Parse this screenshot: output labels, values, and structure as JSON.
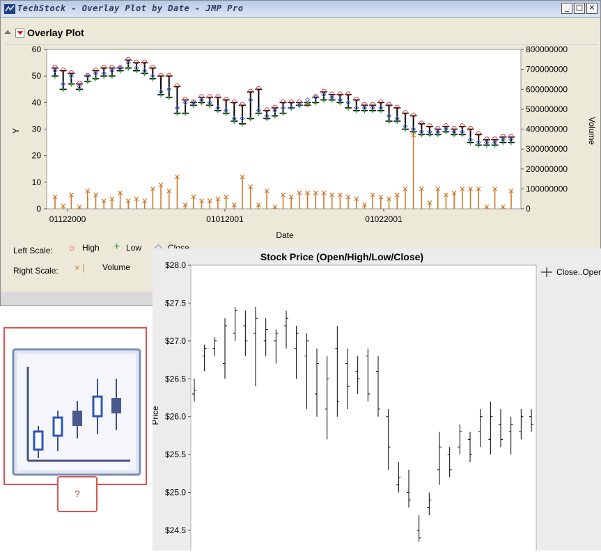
{
  "window": {
    "title": "TechStock - Overlay Plot by Date - JMP Pro",
    "buttons": {
      "minimize": "_",
      "maximize": "□",
      "close": "×"
    }
  },
  "overlay_plot": {
    "title": "Overlay Plot",
    "x_label": "Date",
    "y_label": "Y",
    "y2_label": "Volume",
    "left_axis_ticks": [
      "0",
      "10",
      "20",
      "30",
      "40",
      "50",
      "60"
    ],
    "right_axis_ticks": [
      "0",
      "100000000",
      "200000000",
      "300000000",
      "400000000",
      "500000000",
      "600000000",
      "700000000",
      "800000000"
    ],
    "x_ticks": [
      "01122000",
      "01012001",
      "01022001"
    ],
    "legend": {
      "left_scale_label": "Left Scale:",
      "right_scale_label": "Right Scale:",
      "high": "High",
      "low": "Low",
      "close": "Close",
      "volume_markers": "×   |",
      "volume": "Volume",
      "high_marker": "○",
      "low_marker": "+",
      "close_marker": "◇"
    },
    "colors": {
      "high": "#d33b3b",
      "low": "#2f9c2f",
      "close": "#4a6fd6",
      "volume": "#d0792a"
    }
  },
  "stock_chart": {
    "title": "Stock Price (Open/High/Low/Close)",
    "y_label": "Price",
    "y_ticks": [
      "$24.5",
      "$25.0",
      "$25.5",
      "$26.0",
      "$26.5",
      "$27.0",
      "$27.5",
      "$28.0"
    ],
    "legend_label": "Close..Open"
  },
  "chart_icon": {
    "name": "candlestick-chart-icon"
  },
  "help_box": {
    "text": "?"
  },
  "chart_data": [
    {
      "type": "line",
      "title": "Overlay Plot",
      "xlabel": "Date",
      "ylabel": "Y",
      "y2label": "Volume",
      "ylim": [
        0,
        60
      ],
      "y2lim": [
        0,
        800000000
      ],
      "x_ticks": [
        "01122000",
        "01012001",
        "01022001"
      ],
      "series": [
        {
          "name": "High",
          "axis": "left",
          "values": [
            53,
            52,
            51,
            47,
            50,
            52,
            53,
            53,
            53,
            56,
            55,
            55,
            53,
            50,
            50,
            46,
            41,
            40,
            42,
            42,
            42,
            41,
            40,
            39,
            44,
            45,
            37,
            38,
            40,
            40,
            40,
            39,
            42,
            44,
            43,
            43,
            43,
            41,
            39,
            39,
            40,
            39,
            38,
            36,
            35,
            32,
            31,
            30,
            31,
            30,
            31,
            30,
            28,
            26,
            26,
            27,
            27
          ]
        },
        {
          "name": "Low",
          "axis": "left",
          "values": [
            50,
            45,
            47,
            45,
            48,
            49,
            50,
            50,
            52,
            53,
            52,
            51,
            49,
            43,
            42,
            36,
            36,
            39,
            40,
            39,
            37,
            36,
            33,
            32,
            34,
            36,
            34,
            35,
            36,
            38,
            39,
            40,
            40,
            41,
            41,
            40,
            38,
            37,
            37,
            37,
            37,
            33,
            33,
            30,
            29,
            28,
            28,
            28,
            29,
            28,
            28,
            25,
            24,
            24,
            24,
            25,
            25
          ]
        },
        {
          "name": "Close",
          "axis": "left",
          "values": [
            52,
            47,
            50,
            46,
            50,
            51,
            51,
            52,
            53,
            55,
            53,
            52,
            50,
            44,
            45,
            38,
            40,
            40,
            41,
            40,
            38,
            37,
            34,
            34,
            41,
            37,
            35,
            37,
            38,
            38,
            39,
            41,
            42,
            43,
            42,
            41,
            40,
            38,
            38,
            38,
            38,
            35,
            34,
            31,
            30,
            29,
            29,
            29,
            30,
            29,
            29,
            26,
            25,
            25,
            25,
            26,
            26
          ]
        },
        {
          "name": "Volume",
          "axis": "right",
          "values": [
            60000000,
            15000000,
            70000000,
            10000000,
            90000000,
            70000000,
            40000000,
            50000000,
            80000000,
            40000000,
            50000000,
            40000000,
            100000000,
            120000000,
            90000000,
            160000000,
            20000000,
            60000000,
            40000000,
            40000000,
            50000000,
            60000000,
            20000000,
            160000000,
            110000000,
            20000000,
            90000000,
            10000000,
            70000000,
            60000000,
            80000000,
            80000000,
            80000000,
            80000000,
            70000000,
            70000000,
            60000000,
            50000000,
            20000000,
            70000000,
            60000000,
            50000000,
            70000000,
            100000000,
            370000000,
            100000000,
            30000000,
            100000000,
            70000000,
            80000000,
            100000000,
            100000000,
            100000000,
            10000000,
            100000000,
            10000000,
            90000000
          ]
        }
      ]
    },
    {
      "type": "line",
      "title": "Stock Price (Open/High/Low/Close)",
      "ylabel": "Price",
      "ylim": [
        24.3,
        28.0
      ],
      "series": [
        {
          "name": "Close..Open",
          "note": "OHLC bars",
          "values": [
            {
              "h": 26.5,
              "l": 26.2,
              "o": 26.3,
              "c": 26.35
            },
            {
              "h": 26.95,
              "l": 26.6,
              "o": 26.8,
              "c": 26.9
            },
            {
              "h": 27.05,
              "l": 26.8,
              "o": 26.9,
              "c": 27.0
            },
            {
              "h": 27.3,
              "l": 26.5,
              "o": 26.7,
              "c": 27.2
            },
            {
              "h": 27.45,
              "l": 27.0,
              "o": 27.1,
              "c": 27.4
            },
            {
              "h": 27.4,
              "l": 26.8,
              "o": 27.2,
              "c": 27.0
            },
            {
              "h": 27.45,
              "l": 26.4,
              "o": 27.1,
              "c": 27.3
            },
            {
              "h": 27.3,
              "l": 26.8,
              "o": 27.0,
              "c": 27.15
            },
            {
              "h": 27.15,
              "l": 26.7,
              "o": 27.0,
              "c": 27.1
            },
            {
              "h": 27.4,
              "l": 26.9,
              "o": 27.2,
              "c": 27.3
            },
            {
              "h": 27.2,
              "l": 26.5,
              "o": 26.9,
              "c": 27.1
            },
            {
              "h": 27.1,
              "l": 26.1,
              "o": 26.8,
              "c": 27.0
            },
            {
              "h": 26.9,
              "l": 26.0,
              "o": 26.3,
              "c": 26.7
            },
            {
              "h": 26.8,
              "l": 25.7,
              "o": 26.1,
              "c": 26.5
            },
            {
              "h": 27.2,
              "l": 26.0,
              "o": 26.9,
              "c": 26.2
            },
            {
              "h": 26.9,
              "l": 26.1,
              "o": 26.7,
              "c": 26.4
            },
            {
              "h": 26.8,
              "l": 26.3,
              "o": 26.6,
              "c": 26.5
            },
            {
              "h": 26.9,
              "l": 26.2,
              "o": 26.8,
              "c": 26.3
            },
            {
              "h": 26.8,
              "l": 26.0,
              "o": 26.6,
              "c": 26.1
            },
            {
              "h": 26.1,
              "l": 25.3,
              "o": 26.0,
              "c": 25.6
            },
            {
              "h": 25.4,
              "l": 25.0,
              "o": 25.1,
              "c": 25.2
            },
            {
              "h": 25.3,
              "l": 24.8,
              "o": 25.0,
              "c": 24.9
            },
            {
              "h": 24.7,
              "l": 24.35,
              "o": 24.5,
              "c": 24.4
            },
            {
              "h": 25.0,
              "l": 24.7,
              "o": 24.8,
              "c": 24.9
            },
            {
              "h": 25.8,
              "l": 25.1,
              "o": 25.3,
              "c": 25.6
            },
            {
              "h": 25.6,
              "l": 25.2,
              "o": 25.5,
              "c": 25.3
            },
            {
              "h": 25.9,
              "l": 25.5,
              "o": 25.6,
              "c": 25.8
            },
            {
              "h": 25.8,
              "l": 25.4,
              "o": 25.7,
              "c": 25.5
            },
            {
              "h": 26.1,
              "l": 25.6,
              "o": 25.8,
              "c": 26.0
            },
            {
              "h": 26.2,
              "l": 25.5,
              "o": 25.7,
              "c": 26.0
            },
            {
              "h": 26.1,
              "l": 25.6,
              "o": 25.9,
              "c": 25.7
            },
            {
              "h": 26.0,
              "l": 25.5,
              "o": 25.8,
              "c": 25.9
            },
            {
              "h": 26.1,
              "l": 25.7,
              "o": 25.8,
              "c": 26.0
            },
            {
              "h": 26.1,
              "l": 25.8,
              "o": 26.0,
              "c": 25.9
            }
          ]
        }
      ]
    }
  ]
}
